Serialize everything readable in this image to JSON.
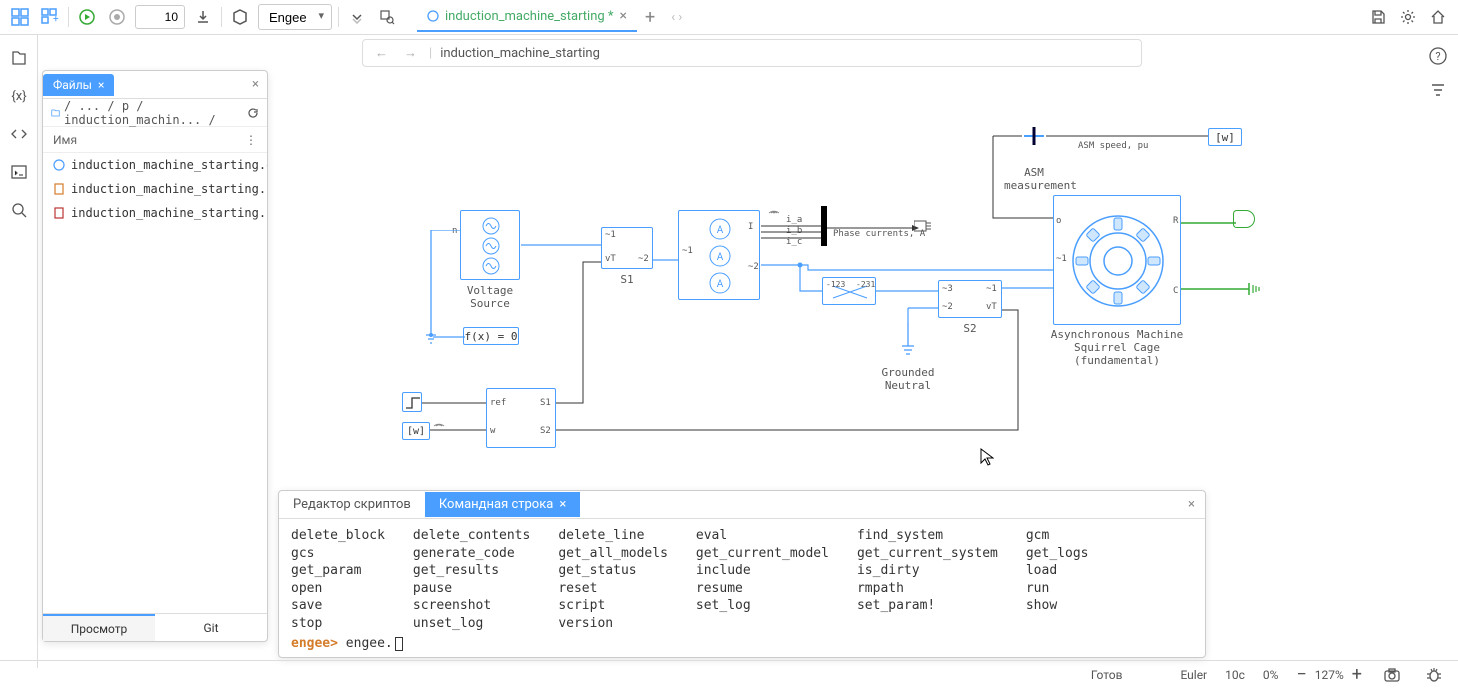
{
  "toolbar": {
    "sim_time": "10",
    "engine_select": "Engee",
    "tab_label": "induction_machine_starting *",
    "breadcrumb": "induction_machine_starting"
  },
  "files": {
    "tab_label": "Файлы",
    "path": "/ ... / p / induction_machin...  /",
    "header_name": "Имя",
    "items": [
      "induction_machine_starting.e",
      "induction_machine_starting.n",
      "induction_machine_starting.s"
    ],
    "footer_view": "Просмотр",
    "footer_git": "Git"
  },
  "diagram": {
    "voltage_source": "Voltage\nSource",
    "fx_eq": "f(x) = 0",
    "s1": "S1",
    "s2": "S2",
    "grounded_neutral": "Grounded\nNeutral",
    "asm_measurement": "ASM\nmeasurement",
    "asm_speed": "ASM speed, pu",
    "phase_currents": "Phase currents, A",
    "machine": "Asynchronous Machine\nSquirrel Cage\n(fundamental)",
    "port_ref": "ref",
    "port_w": "w",
    "port_s1": "S1",
    "port_s2": "S2",
    "port_vt": "vT",
    "port_n1": "~1",
    "port_n2": "~2",
    "port_n3": "~3",
    "port_i": "I",
    "port_ia": "i_a",
    "port_ib": "i_b",
    "port_ic": "i_c",
    "port_r": "R",
    "port_c": "C",
    "port_n": "n",
    "goto_w": "[w]",
    "neg123": "-123",
    "neg231": "-231"
  },
  "console": {
    "tab_script": "Редактор скриптов",
    "tab_cmd": "Командная строка",
    "col1": [
      "delete_block",
      "gcs",
      "get_param",
      "open",
      "save",
      "stop"
    ],
    "col2": [
      "delete_contents",
      "generate_code",
      "get_results",
      "pause",
      "screenshot",
      "unset_log"
    ],
    "col3": [
      "delete_line",
      "get_all_models",
      "get_status",
      "reset",
      "script",
      "version"
    ],
    "col4": [
      "eval",
      "get_current_model",
      "include",
      "resume",
      "set_log"
    ],
    "col5": [
      "find_system",
      "get_current_system",
      "is_dirty",
      "rmpath",
      "set_param!"
    ],
    "col6": [
      "gcm",
      "get_logs",
      "load",
      "run",
      "show"
    ],
    "prompt": "engee>",
    "prompt_text": "engee."
  },
  "status": {
    "ready": "Готов",
    "solver": "Euler",
    "time": "10c",
    "percent": "0%",
    "zoom": "127%"
  }
}
